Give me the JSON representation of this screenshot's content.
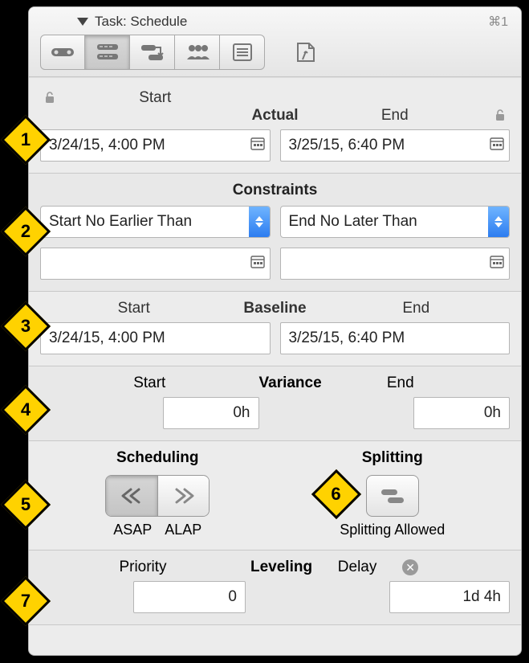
{
  "header": {
    "title": "Task: Schedule",
    "shortcut": "⌘1"
  },
  "actual": {
    "title": "Actual",
    "start_label": "Start",
    "end_label": "End",
    "start_value": "3/24/15, 4:00 PM",
    "end_value": "3/25/15, 6:40 PM"
  },
  "constraints": {
    "title": "Constraints",
    "start_option": "Start No Earlier Than",
    "end_option": "End No Later Than",
    "start_value": "",
    "end_value": ""
  },
  "baseline": {
    "title": "Baseline",
    "start_label": "Start",
    "end_label": "End",
    "start_value": "3/24/15, 4:00 PM",
    "end_value": "3/25/15, 6:40 PM"
  },
  "variance": {
    "title": "Variance",
    "start_label": "Start",
    "end_label": "End",
    "start_value": "0h",
    "end_value": "0h"
  },
  "scheduling": {
    "title": "Scheduling",
    "asap_label": "ASAP",
    "alap_label": "ALAP"
  },
  "splitting": {
    "title": "Splitting",
    "allowed_label": "Splitting Allowed"
  },
  "leveling": {
    "title": "Leveling",
    "priority_label": "Priority",
    "priority_value": "0",
    "delay_label": "Delay",
    "delay_value": "1d 4h"
  },
  "callouts": {
    "c1": "1",
    "c2": "2",
    "c3": "3",
    "c4": "4",
    "c5": "5",
    "c6": "6",
    "c7": "7"
  }
}
